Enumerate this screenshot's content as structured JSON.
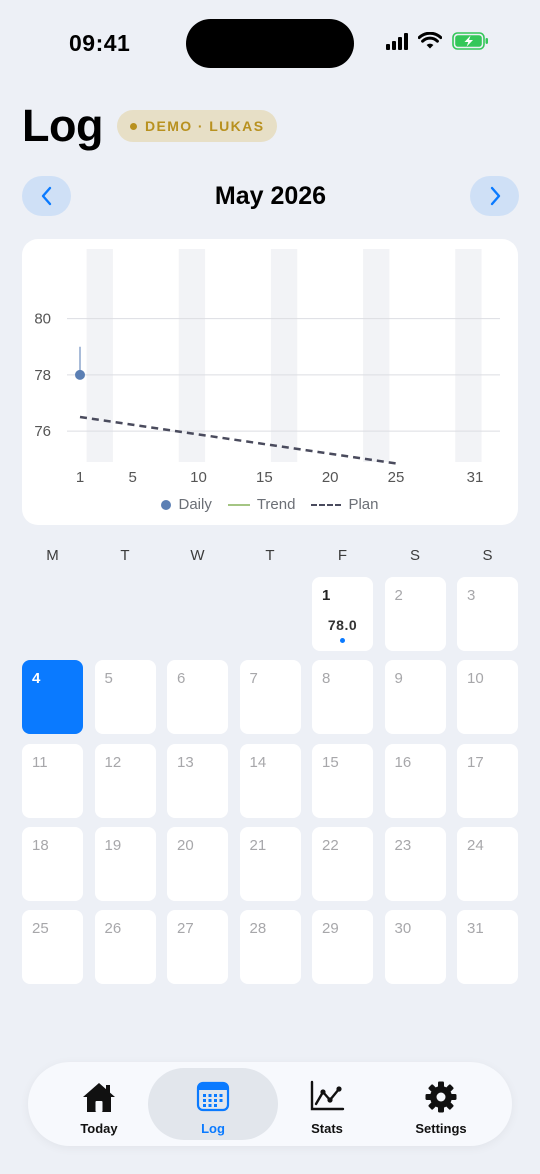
{
  "status_bar": {
    "time": "09:41"
  },
  "header": {
    "title": "Log",
    "badge": "DEMO · LUKAS"
  },
  "month_nav": {
    "title": "May 2026",
    "prev_icon": "chevron-left-icon",
    "next_icon": "chevron-right-icon"
  },
  "chart_data": {
    "type": "line",
    "x_ticks": [
      "1",
      "5",
      "10",
      "15",
      "20",
      "25",
      "31"
    ],
    "y_ticks": [
      "80",
      "78",
      "76"
    ],
    "xlim": [
      1,
      31
    ],
    "ylim": [
      74.9,
      82.3
    ],
    "weekend_bands": true,
    "series": [
      {
        "name": "Daily",
        "kind": "points",
        "color": "#5b7fb4",
        "x": [
          1
        ],
        "y": [
          78.0
        ],
        "range": [
          [
            77.9,
            79.0
          ]
        ]
      },
      {
        "name": "Trend",
        "kind": "line",
        "color": "#a4c583",
        "x": [],
        "y": []
      },
      {
        "name": "Plan",
        "kind": "dashed-line",
        "color": "#4a4b5d",
        "x": [
          1,
          25
        ],
        "y": [
          76.5,
          74.85
        ]
      }
    ],
    "legend": [
      "Daily",
      "Trend",
      "Plan"
    ],
    "legend_placement": "bottom-center"
  },
  "calendar": {
    "weekdays": [
      "M",
      "T",
      "W",
      "T",
      "F",
      "S",
      "S"
    ],
    "first_weekday_index": 4,
    "days_in_month": 31,
    "today": 4,
    "entries": {
      "1": "78.0"
    }
  },
  "tabs": [
    {
      "label": "Today",
      "icon": "house-icon",
      "active": false
    },
    {
      "label": "Log",
      "icon": "calendar-icon",
      "active": true
    },
    {
      "label": "Stats",
      "icon": "chart-line-icon",
      "active": false
    },
    {
      "label": "Settings",
      "icon": "gear-icon",
      "active": false
    }
  ],
  "colors": {
    "accent": "#0a7aff",
    "badge_text": "#b8911f",
    "badge_bg": "#e7dfc6",
    "background": "#edf0f6"
  }
}
